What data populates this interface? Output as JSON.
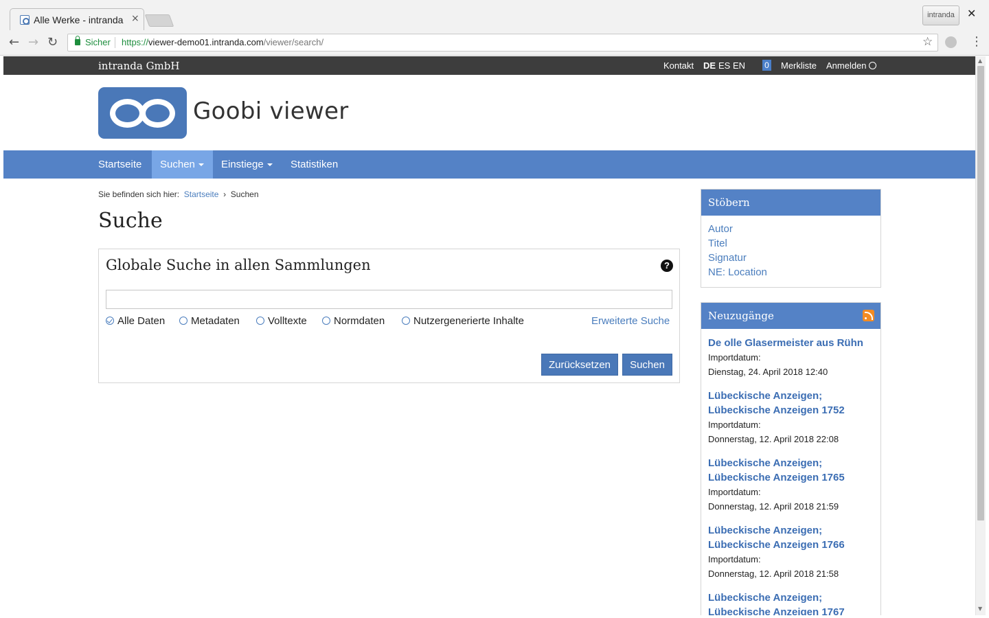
{
  "browser": {
    "tab_title": "Alle Werke - intranda",
    "tab_close": "×",
    "profile_label": "intranda",
    "window_close": "✕",
    "secure_label": "Sicher",
    "url_scheme": "https://",
    "url_host": "viewer-demo01.intranda.com",
    "url_path": "/viewer/search/"
  },
  "topbar": {
    "company": "intranda GmbH",
    "contact": "Kontakt",
    "languages": [
      "DE",
      "ES",
      "EN"
    ],
    "bookmark_count": "0",
    "bookmarks": "Merkliste",
    "login": "Anmelden"
  },
  "header": {
    "site_title": "Goobi viewer"
  },
  "nav": {
    "items": [
      {
        "label": "Startseite"
      },
      {
        "label": "Suchen"
      },
      {
        "label": "Einstiege"
      },
      {
        "label": "Statistiken"
      }
    ]
  },
  "breadcrumb": {
    "prefix": "Sie befinden sich hier:",
    "home": "Startseite",
    "separator": "›",
    "current": "Suchen"
  },
  "page": {
    "title": "Suche"
  },
  "search": {
    "panel_title": "Globale Suche in allen Sammlungen",
    "help": "?",
    "query": "",
    "options": [
      "Alle Daten",
      "Metadaten",
      "Volltexte",
      "Normdaten",
      "Nutzergenerierte Inhalte"
    ],
    "selected_option": "Alle Daten",
    "advanced_link": "Erweiterte Suche",
    "reset_label": "Zurücksetzen",
    "submit_label": "Suchen"
  },
  "browse": {
    "title": "Stöbern",
    "items": [
      "Autor",
      "Titel",
      "Signatur",
      "NE: Location"
    ]
  },
  "news": {
    "title": "Neuzugänge",
    "items": [
      {
        "title": "De olle Glasermeister aus Rühn",
        "label": "Importdatum:",
        "date": "Dienstag, 24. April 2018 12:40"
      },
      {
        "title": "Lübeckische Anzeigen; Lübeckische Anzeigen 1752",
        "label": "Importdatum:",
        "date": "Donnerstag, 12. April 2018 22:08"
      },
      {
        "title": "Lübeckische Anzeigen; Lübeckische Anzeigen 1765",
        "label": "Importdatum:",
        "date": "Donnerstag, 12. April 2018 21:59"
      },
      {
        "title": "Lübeckische Anzeigen; Lübeckische Anzeigen 1766",
        "label": "Importdatum:",
        "date": "Donnerstag, 12. April 2018 21:58"
      },
      {
        "title": "Lübeckische Anzeigen; Lübeckische Anzeigen 1767",
        "label": "",
        "date": ""
      }
    ]
  },
  "colors": {
    "brand_blue": "#5482c6",
    "link_blue": "#4a7dbd",
    "topbar": "#3d3d3d"
  }
}
